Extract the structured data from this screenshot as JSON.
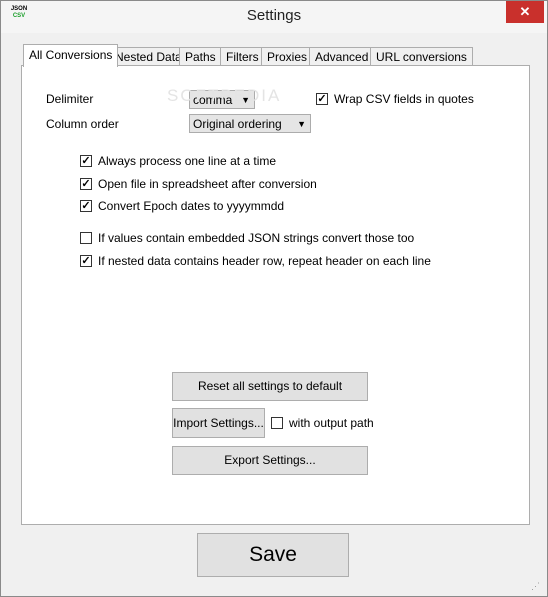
{
  "window": {
    "title": "Settings",
    "close_label": "✕",
    "icon_top": "JSON",
    "icon_bottom": "CSV"
  },
  "tabs": [
    {
      "label": "All Conversions"
    },
    {
      "label": "Nested Data"
    },
    {
      "label": "Paths"
    },
    {
      "label": "Filters"
    },
    {
      "label": "Proxies"
    },
    {
      "label": "Advanced"
    },
    {
      "label": "URL conversions"
    }
  ],
  "form": {
    "delimiter_label": "Delimiter",
    "delimiter_value": "comma",
    "wrap_csv_label": "Wrap CSV fields in quotes",
    "wrap_csv_checked": true,
    "column_order_label": "Column order",
    "column_order_value": "Original ordering"
  },
  "options": [
    {
      "label": "Always process one line at a time",
      "checked": true
    },
    {
      "label": "Open file in spreadsheet after conversion",
      "checked": true
    },
    {
      "label": "Convert Epoch dates to yyyymmdd",
      "checked": true
    },
    {
      "label": "If values contain embedded JSON strings convert those too",
      "checked": false
    },
    {
      "label": "If nested data contains header row, repeat header on each line",
      "checked": true
    }
  ],
  "buttons": {
    "reset": "Reset all settings to default",
    "import": "Import Settings...",
    "with_output_path": "with output path",
    "with_output_path_checked": false,
    "export": "Export Settings...",
    "save": "Save"
  },
  "watermark": "SOFTPEDIA"
}
